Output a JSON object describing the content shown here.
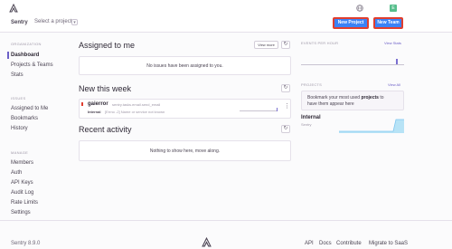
{
  "header": {
    "org_name": "Sentry",
    "select_project": "Select a project",
    "new_project": "New Project",
    "new_team": "New Team",
    "avatar_letter": "E"
  },
  "sidebar": {
    "organization_heading": "ORGANIZATION",
    "org_items": [
      "Dashboard",
      "Projects & Teams",
      "Stats"
    ],
    "issues_heading": "ISSUES",
    "issues_items": [
      "Assigned to Me",
      "Bookmarks",
      "History"
    ],
    "manage_heading": "MANAGE",
    "manage_items": [
      "Members",
      "Auth",
      "API Keys",
      "Audit Log",
      "Rate Limits",
      "Settings"
    ]
  },
  "assigned": {
    "title": "Assigned to me",
    "view_more": "View more",
    "empty": "No issues have been assigned to you."
  },
  "new_week": {
    "title": "New this week",
    "issue_name": "gaierror",
    "issue_subtitle": "sentry.tasks.email.send_email",
    "issue_project": "Internal",
    "issue_message": "[Errno -2] Name or service not known"
  },
  "recent": {
    "title": "Recent activity",
    "empty": "Nothing to show here, move along."
  },
  "right": {
    "events_heading": "EVENTS PER HOUR",
    "view_stats": "View Stats",
    "projects_heading": "PROJECTS",
    "view_all": "View All",
    "bookmark_text_1": "Bookmark your most used",
    "bookmark_bold": "projects",
    "bookmark_text_2": "to",
    "bookmark_text_3": "have them appear here",
    "project_name": "Internal",
    "project_org": "Sentry"
  },
  "footer": {
    "version": "Sentry 8.9.0",
    "links": [
      "API",
      "Docs",
      "Contribute",
      "Migrate to SaaS"
    ]
  },
  "colors": {
    "accent": "#6c5fc7",
    "button": "#3b82f6",
    "highlight_border": "#e03e2f",
    "sparkline": "#7fc7f0"
  }
}
